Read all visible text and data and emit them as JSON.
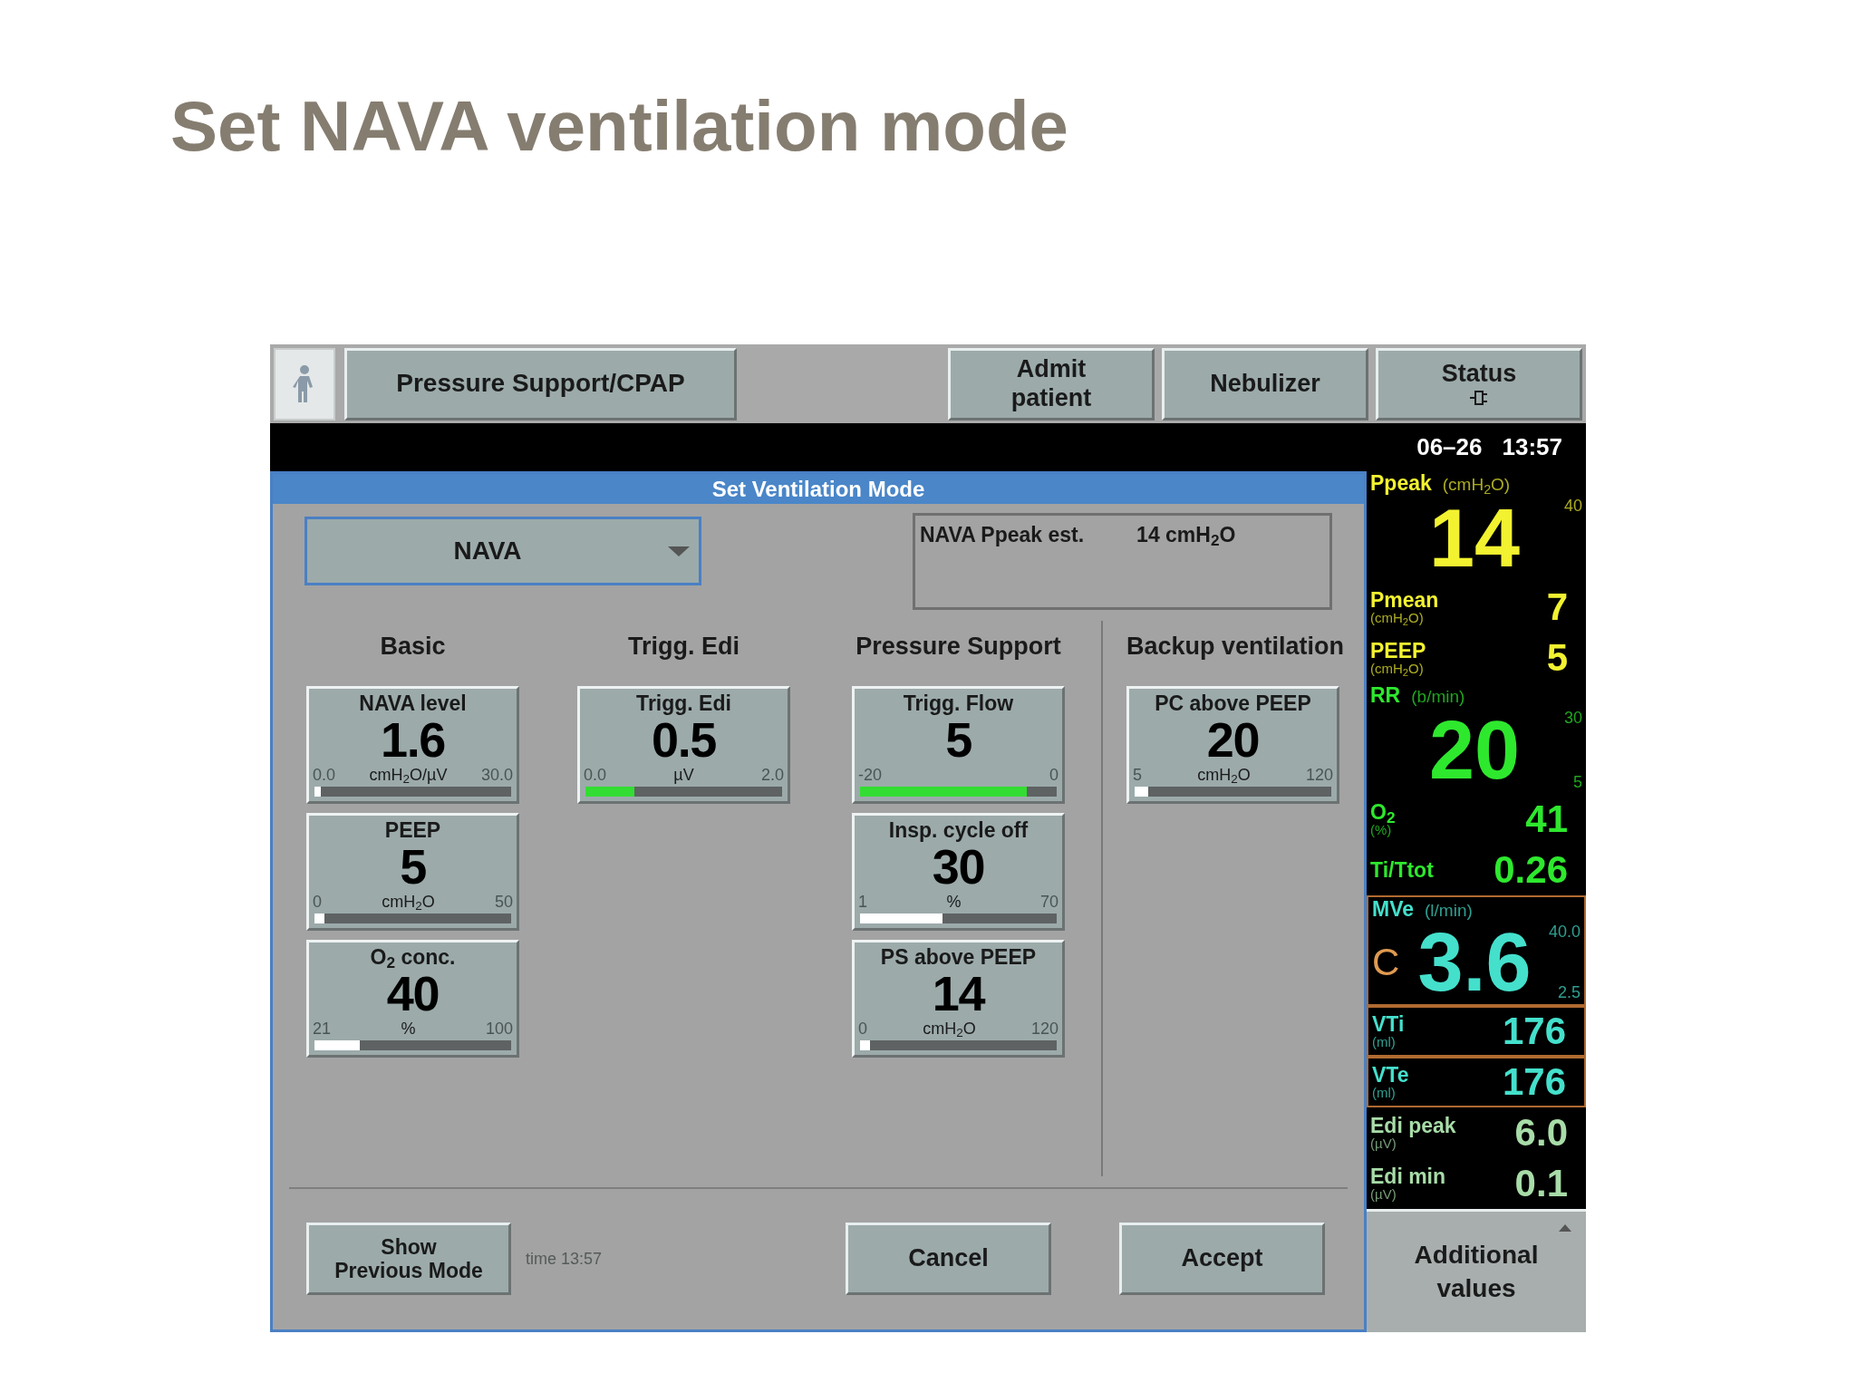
{
  "slide_title": "Set NAVA ventilation mode",
  "top_bar": {
    "mode": "Pressure Support/CPAP",
    "buttons": [
      {
        "kind": "text",
        "label": "Admit\npatient"
      },
      {
        "kind": "text",
        "label": "Nebulizer"
      },
      {
        "kind": "status",
        "label": "Status"
      }
    ]
  },
  "dialog": {
    "title": "Set Ventilation Mode",
    "mode_select": {
      "value": "NAVA"
    },
    "estimate": {
      "label": "NAVA Ppeak est.",
      "value": "14 cmH$_{2}$O"
    },
    "columns": [
      {
        "heading": "Basic",
        "cards": [
          {
            "title": "NAVA level",
            "value": "1.6",
            "unit": "cmH$_{2}$O/µV",
            "min": "0.0",
            "max": "30.0",
            "level": 0.03,
            "color": "#ffffff"
          },
          {
            "title": "PEEP",
            "value": "5",
            "unit": "cmH$_{2}$O",
            "min": "0",
            "max": "50",
            "level": 0.05,
            "color": "#ffffff"
          },
          {
            "title": "O$_{2}$ conc.",
            "value": "40",
            "unit": "%",
            "min": "21",
            "max": "100",
            "level": 0.23,
            "color": "#ffffff"
          }
        ]
      },
      {
        "heading": "Trigg. Edi",
        "cards": [
          {
            "title": "Trigg. Edi",
            "value": "0.5",
            "unit": "µV",
            "min": "0.0",
            "max": "2.0",
            "level": 0.25,
            "color": "#33dd33"
          }
        ]
      },
      {
        "heading": "Pressure Support",
        "cards": [
          {
            "title": "Trigg. Flow",
            "value": "5",
            "min": "-20",
            "max": "0",
            "level": 0.85,
            "color": "#33dd33"
          },
          {
            "title": "Insp. cycle off",
            "value": "30",
            "unit": "%",
            "min": "1",
            "max": "70",
            "level": 0.42,
            "color": "#ffffff"
          },
          {
            "title": "PS above PEEP",
            "value": "14",
            "unit": "cmH$_{2}$O",
            "min": "0",
            "max": "120",
            "level": 0.05,
            "color": "#ffffff"
          }
        ]
      },
      {
        "heading": "Backup ventilation",
        "cards": [
          {
            "title": "PC above PEEP",
            "value": "20",
            "unit": "cmH$_{2}$O",
            "min": "5",
            "max": "120",
            "level": 0.07,
            "color": "#ffffff"
          }
        ]
      }
    ],
    "footer": {
      "previous_button": "Show\nPrevious Mode",
      "time_note": "time 13:57",
      "cancel": "Cancel",
      "accept": "Accept"
    }
  },
  "monitor": {
    "date": "06–26",
    "time": "13:57",
    "items": [
      {
        "kind": "large",
        "label": "Ppeak",
        "unit": "(cmH$_{2}$O)",
        "value": "14",
        "high": "40",
        "color": "#f2f230",
        "boxed": false
      },
      {
        "kind": "small",
        "label": "Pmean",
        "unit": "(cmH$_{2}$O)",
        "value": "7",
        "color": "#f2f230",
        "boxed": false
      },
      {
        "kind": "small",
        "label": "PEEP",
        "unit": "(cmH$_{2}$O)",
        "value": "5",
        "color": "#f2f230",
        "boxed": false
      },
      {
        "kind": "large",
        "label": "RR",
        "unit": "(b/min)",
        "value": "20",
        "high": "30",
        "low": "5",
        "color": "#2ee82e",
        "boxed": false
      },
      {
        "kind": "small",
        "label": "O$_{2}$",
        "unit": "(%)",
        "value": "41",
        "color": "#2ee82e",
        "boxed": false
      },
      {
        "kind": "small",
        "label": "Ti/Ttot",
        "value": "0.26",
        "color": "#2ee82e",
        "boxed": false
      },
      {
        "kind": "large",
        "label": "MVe",
        "unit": "(l/min)",
        "prefix": "C",
        "value": "3.6",
        "high": "40.0",
        "low": "2.5",
        "color": "#44e0cc",
        "boxed": true
      },
      {
        "kind": "small",
        "label": "VTi",
        "unit": "(ml)",
        "value": "176",
        "color": "#44e0cc",
        "boxed": true
      },
      {
        "kind": "small",
        "label": "VTe",
        "unit": "(ml)",
        "value": "176",
        "color": "#44e0cc",
        "boxed": true
      },
      {
        "kind": "small",
        "label": "Edi peak",
        "unit": "(µV)",
        "value": "6.0",
        "color": "#a8dca8",
        "boxed": false
      },
      {
        "kind": "small",
        "label": "Edi min",
        "unit": "(µV)",
        "value": "0.1",
        "color": "#a8dca8",
        "boxed": false
      }
    ],
    "additional_button": "Additional\nvalues"
  }
}
